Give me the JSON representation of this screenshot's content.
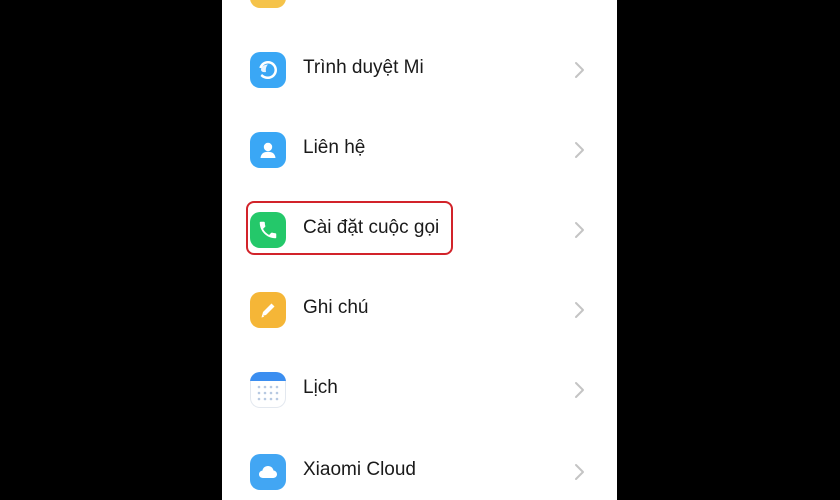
{
  "settings": {
    "items": [
      {
        "label": "Trình duyệt Mi",
        "icon": "browser-icon",
        "color": "#3aa7f5"
      },
      {
        "label": "Liên hệ",
        "icon": "contact-icon",
        "color": "#3aa7f5"
      },
      {
        "label": "Cài đặt cuộc gọi",
        "icon": "phone-icon",
        "color": "#24c86a"
      },
      {
        "label": "Ghi chú",
        "icon": "notes-icon",
        "color": "#f5b637"
      },
      {
        "label": "Lịch",
        "icon": "calendar-icon",
        "color": "#3b8ef0"
      },
      {
        "label": "Xiaomi Cloud",
        "icon": "cloud-icon",
        "color": "#42a6f3"
      }
    ],
    "highlighted_item": "Cài đặt cuộc gọi",
    "highlight_color": "#d2232a"
  }
}
